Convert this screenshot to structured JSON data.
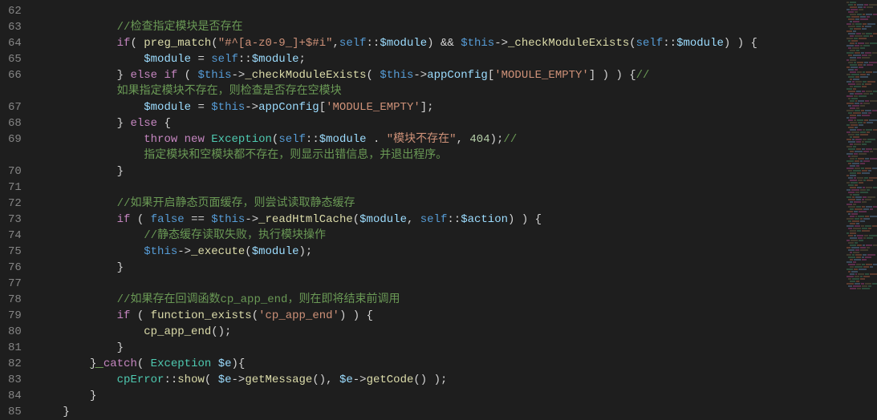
{
  "gutter": {
    "start": 62,
    "end": 85
  },
  "lines": {
    "62": [],
    "63": [
      {
        "t": "            ",
        "c": "op"
      },
      {
        "t": "//检查指定模块是否存在",
        "c": "comment"
      }
    ],
    "64": [
      {
        "t": "            ",
        "c": "op"
      },
      {
        "t": "if",
        "c": "keyword"
      },
      {
        "t": "( ",
        "c": "punct"
      },
      {
        "t": "preg_match",
        "c": "func"
      },
      {
        "t": "(",
        "c": "punct"
      },
      {
        "t": "\"#^[a-z0-9_]+$#i\"",
        "c": "string"
      },
      {
        "t": ",",
        "c": "punct"
      },
      {
        "t": "self",
        "c": "const"
      },
      {
        "t": "::",
        "c": "op"
      },
      {
        "t": "$module",
        "c": "var"
      },
      {
        "t": ") ",
        "c": "punct"
      },
      {
        "t": "&&",
        "c": "op"
      },
      {
        "t": " ",
        "c": "op"
      },
      {
        "t": "$this",
        "c": "const"
      },
      {
        "t": "->",
        "c": "op"
      },
      {
        "t": "_checkModuleExists",
        "c": "func"
      },
      {
        "t": "(",
        "c": "punct"
      },
      {
        "t": "self",
        "c": "const"
      },
      {
        "t": "::",
        "c": "op"
      },
      {
        "t": "$module",
        "c": "var"
      },
      {
        "t": ") ) {",
        "c": "punct"
      }
    ],
    "65": [
      {
        "t": "                ",
        "c": "op"
      },
      {
        "t": "$module",
        "c": "var"
      },
      {
        "t": " = ",
        "c": "op"
      },
      {
        "t": "self",
        "c": "const"
      },
      {
        "t": "::",
        "c": "op"
      },
      {
        "t": "$module",
        "c": "var"
      },
      {
        "t": ";",
        "c": "punct"
      }
    ],
    "66": [
      {
        "t": "            } ",
        "c": "punct"
      },
      {
        "t": "else",
        "c": "keyword"
      },
      {
        "t": " ",
        "c": "op"
      },
      {
        "t": "if",
        "c": "keyword"
      },
      {
        "t": " ( ",
        "c": "punct"
      },
      {
        "t": "$this",
        "c": "const"
      },
      {
        "t": "->",
        "c": "op"
      },
      {
        "t": "_checkModuleExists",
        "c": "func"
      },
      {
        "t": "( ",
        "c": "punct"
      },
      {
        "t": "$this",
        "c": "const"
      },
      {
        "t": "->",
        "c": "op"
      },
      {
        "t": "appConfig",
        "c": "var"
      },
      {
        "t": "[",
        "c": "punct"
      },
      {
        "t": "'MODULE_EMPTY'",
        "c": "string"
      },
      {
        "t": "] ) ) {",
        "c": "punct"
      },
      {
        "t": "//",
        "c": "comment"
      }
    ],
    "66b": [
      {
        "t": "            如果指定模块不存在，则检查是否存在空模块",
        "c": "comment"
      }
    ],
    "67": [
      {
        "t": "                ",
        "c": "op"
      },
      {
        "t": "$module",
        "c": "var"
      },
      {
        "t": " = ",
        "c": "op"
      },
      {
        "t": "$this",
        "c": "const"
      },
      {
        "t": "->",
        "c": "op"
      },
      {
        "t": "appConfig",
        "c": "var"
      },
      {
        "t": "[",
        "c": "punct"
      },
      {
        "t": "'MODULE_EMPTY'",
        "c": "string"
      },
      {
        "t": "];",
        "c": "punct"
      }
    ],
    "68": [
      {
        "t": "            } ",
        "c": "punct"
      },
      {
        "t": "else",
        "c": "keyword"
      },
      {
        "t": " {",
        "c": "punct"
      }
    ],
    "69": [
      {
        "t": "                ",
        "c": "op"
      },
      {
        "t": "throw",
        "c": "keyword"
      },
      {
        "t": " ",
        "c": "op"
      },
      {
        "t": "new",
        "c": "keyword"
      },
      {
        "t": " ",
        "c": "op"
      },
      {
        "t": "Exception",
        "c": "class"
      },
      {
        "t": "(",
        "c": "punct"
      },
      {
        "t": "self",
        "c": "const"
      },
      {
        "t": "::",
        "c": "op"
      },
      {
        "t": "$module",
        "c": "var"
      },
      {
        "t": " . ",
        "c": "op"
      },
      {
        "t": "\"模块不存在\"",
        "c": "string"
      },
      {
        "t": ", ",
        "c": "punct"
      },
      {
        "t": "404",
        "c": "num"
      },
      {
        "t": ");",
        "c": "punct"
      },
      {
        "t": "//",
        "c": "comment"
      }
    ],
    "69b": [
      {
        "t": "                指定模块和空模块都不存在，则显示出错信息，并退出程序。",
        "c": "comment"
      }
    ],
    "70": [
      {
        "t": "            }",
        "c": "punct"
      }
    ],
    "71": [],
    "72": [
      {
        "t": "            ",
        "c": "op"
      },
      {
        "t": "//如果开启静态页面缓存，则尝试读取静态缓存",
        "c": "comment"
      }
    ],
    "73": [
      {
        "t": "            ",
        "c": "op"
      },
      {
        "t": "if",
        "c": "keyword"
      },
      {
        "t": " ( ",
        "c": "punct"
      },
      {
        "t": "false",
        "c": "const"
      },
      {
        "t": " == ",
        "c": "op"
      },
      {
        "t": "$this",
        "c": "const"
      },
      {
        "t": "->",
        "c": "op"
      },
      {
        "t": "_readHtmlCache",
        "c": "func"
      },
      {
        "t": "(",
        "c": "punct"
      },
      {
        "t": "$module",
        "c": "var"
      },
      {
        "t": ", ",
        "c": "punct"
      },
      {
        "t": "self",
        "c": "const"
      },
      {
        "t": "::",
        "c": "op"
      },
      {
        "t": "$action",
        "c": "var"
      },
      {
        "t": ") ) {",
        "c": "punct"
      }
    ],
    "74": [
      {
        "t": "                ",
        "c": "op"
      },
      {
        "t": "//静态缓存读取失败，执行模块操作",
        "c": "comment"
      }
    ],
    "75": [
      {
        "t": "                ",
        "c": "op"
      },
      {
        "t": "$this",
        "c": "const"
      },
      {
        "t": "->",
        "c": "op"
      },
      {
        "t": "_execute",
        "c": "func"
      },
      {
        "t": "(",
        "c": "punct"
      },
      {
        "t": "$module",
        "c": "var"
      },
      {
        "t": ");",
        "c": "punct"
      }
    ],
    "76": [
      {
        "t": "            }",
        "c": "punct"
      }
    ],
    "77": [],
    "78": [
      {
        "t": "            ",
        "c": "op"
      },
      {
        "t": "//如果存在回调函数cp_app_end，则在即将结束前调用",
        "c": "comment"
      }
    ],
    "79": [
      {
        "t": "            ",
        "c": "op"
      },
      {
        "t": "if",
        "c": "keyword"
      },
      {
        "t": " ( ",
        "c": "punct"
      },
      {
        "t": "function_exists",
        "c": "func"
      },
      {
        "t": "(",
        "c": "punct"
      },
      {
        "t": "'cp_app_end'",
        "c": "string"
      },
      {
        "t": ") ) {",
        "c": "punct"
      }
    ],
    "80": [
      {
        "t": "                ",
        "c": "op"
      },
      {
        "t": "cp_app_end",
        "c": "func"
      },
      {
        "t": "();",
        "c": "punct"
      }
    ],
    "81": [
      {
        "t": "            }",
        "c": "punct"
      }
    ],
    "82": [
      {
        "t": "        ",
        "c": "op"
      },
      {
        "t": "} ",
        "c": "punct",
        "u": true
      },
      {
        "t": "catch",
        "c": "keyword"
      },
      {
        "t": "( ",
        "c": "punct"
      },
      {
        "t": "Exception",
        "c": "class"
      },
      {
        "t": " ",
        "c": "op"
      },
      {
        "t": "$e",
        "c": "var"
      },
      {
        "t": "){",
        "c": "punct"
      }
    ],
    "83": [
      {
        "t": "            ",
        "c": "op"
      },
      {
        "t": "cpError",
        "c": "class"
      },
      {
        "t": "::",
        "c": "op"
      },
      {
        "t": "show",
        "c": "func"
      },
      {
        "t": "( ",
        "c": "punct"
      },
      {
        "t": "$e",
        "c": "var"
      },
      {
        "t": "->",
        "c": "op"
      },
      {
        "t": "getMessage",
        "c": "func"
      },
      {
        "t": "(), ",
        "c": "punct"
      },
      {
        "t": "$e",
        "c": "var"
      },
      {
        "t": "->",
        "c": "op"
      },
      {
        "t": "getCode",
        "c": "func"
      },
      {
        "t": "() );",
        "c": "punct"
      }
    ],
    "84": [
      {
        "t": "        }",
        "c": "punct"
      }
    ],
    "85": [
      {
        "t": "    }",
        "c": "punct"
      }
    ]
  },
  "render_order": [
    "62",
    "63",
    "64",
    "65",
    "66",
    "66b",
    "67",
    "68",
    "69",
    "69b",
    "70",
    "71",
    "72",
    "73",
    "74",
    "75",
    "76",
    "77",
    "78",
    "79",
    "80",
    "81",
    "82",
    "83",
    "84",
    "85"
  ],
  "gutter_map": {
    "62": "62",
    "63": "63",
    "64": "64",
    "65": "65",
    "66": "66",
    "66b": "",
    "67": "67",
    "68": "68",
    "69": "69",
    "69b": "",
    "70": "70",
    "71": "71",
    "72": "72",
    "73": "73",
    "74": "74",
    "75": "75",
    "76": "76",
    "77": "77",
    "78": "78",
    "79": "79",
    "80": "80",
    "81": "81",
    "82": "82",
    "83": "83",
    "84": "84",
    "85": "85"
  }
}
